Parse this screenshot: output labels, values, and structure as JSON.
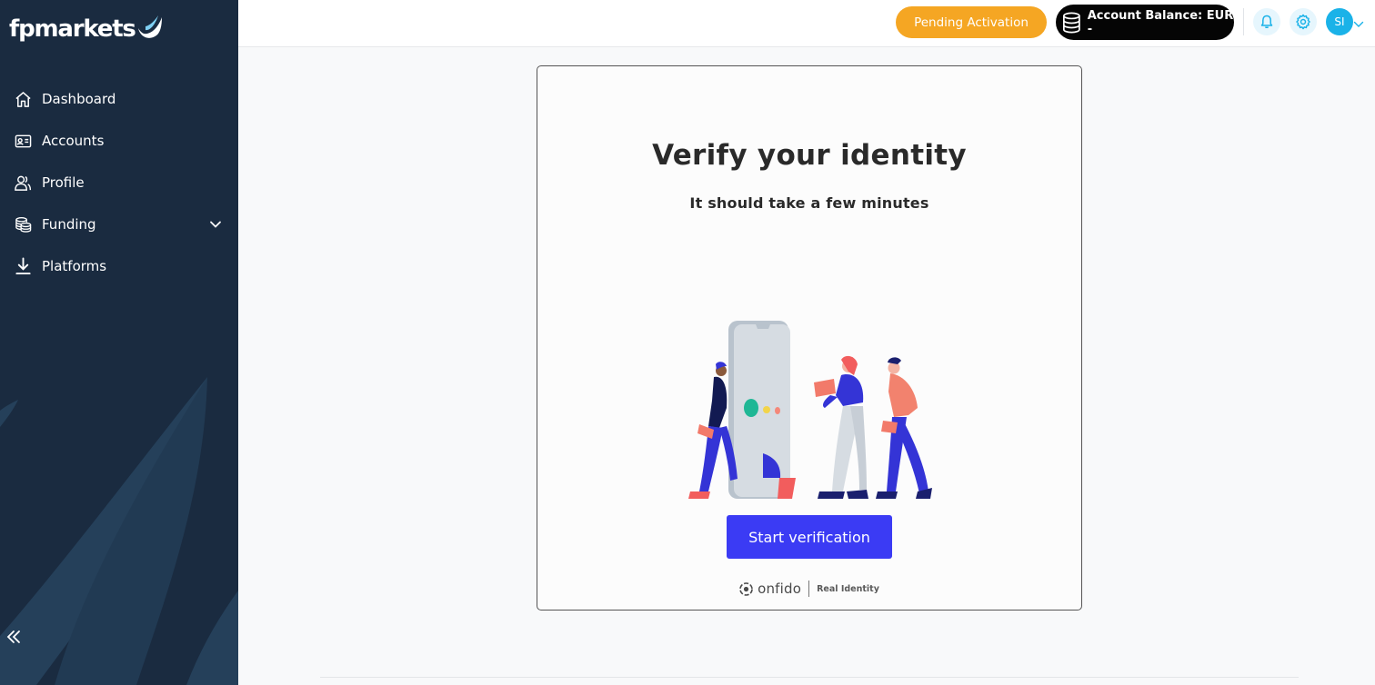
{
  "brand": {
    "logo_text": "fpmarkets"
  },
  "sidebar": {
    "items": [
      {
        "label": "Dashboard",
        "icon": "home-icon"
      },
      {
        "label": "Accounts",
        "icon": "id-card-icon"
      },
      {
        "label": "Profile",
        "icon": "users-icon"
      },
      {
        "label": "Funding",
        "icon": "coins-icon",
        "has_submenu": true
      },
      {
        "label": "Platforms",
        "icon": "download-icon"
      }
    ],
    "collapse_icon": "double-chevron-left-icon"
  },
  "topbar": {
    "status_label": "Pending Activation",
    "balance_label": "Account Balance: EUR -",
    "avatar_initials": "SI",
    "icons": [
      "bell-icon",
      "gear-icon",
      "chevron-down-icon"
    ]
  },
  "verification": {
    "title": "Verify your identity",
    "subtitle": "It should take a few minutes",
    "button_label": "Start verification",
    "provider_name": "onfido",
    "provider_tagline": "Real Identity"
  },
  "colors": {
    "sidebar_bg": "#1a2b40",
    "pending_orange": "#f5a623",
    "primary_button": "#3b3bf4",
    "avatar_cyan": "#1ab2e8"
  }
}
